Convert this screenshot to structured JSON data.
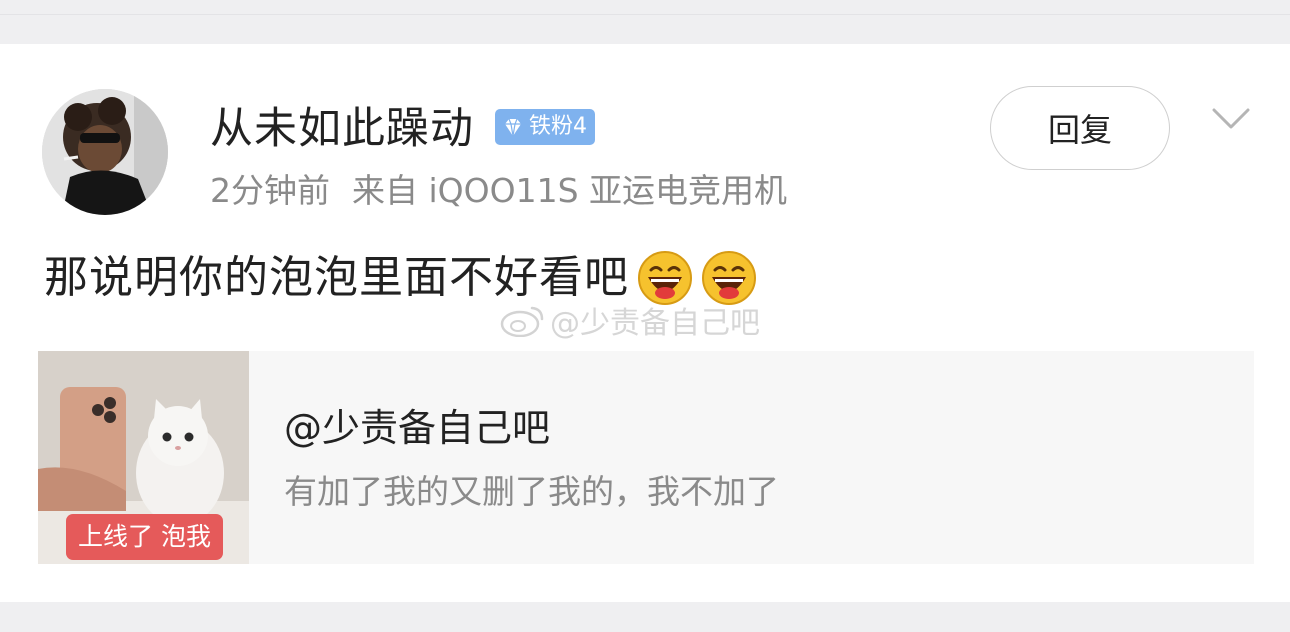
{
  "post": {
    "username": "从未如此躁动",
    "fan_badge": "铁粉4",
    "time": "2分钟前",
    "source": "来自 iQOO11S 亚运电竞用机",
    "reply_label": "回复",
    "comment_text": "那说明你的泡泡里面不好看吧",
    "emojis": [
      "laughing-emoji",
      "laughing-emoji"
    ]
  },
  "watermark": {
    "text": "@少责备自己吧"
  },
  "quote": {
    "name": "@少责备自己吧",
    "text": "有加了我的又删了我的，我不加了",
    "thumb_tag": "上线了 泡我"
  },
  "colors": {
    "page_bg": "#ffffff",
    "band_bg": "#efeff1",
    "badge_bg": "#7fb2ee",
    "meta_text": "#8a8a8a",
    "quote_bg": "#f7f7f7",
    "thumb_tag_bg": "#e55a5a"
  }
}
